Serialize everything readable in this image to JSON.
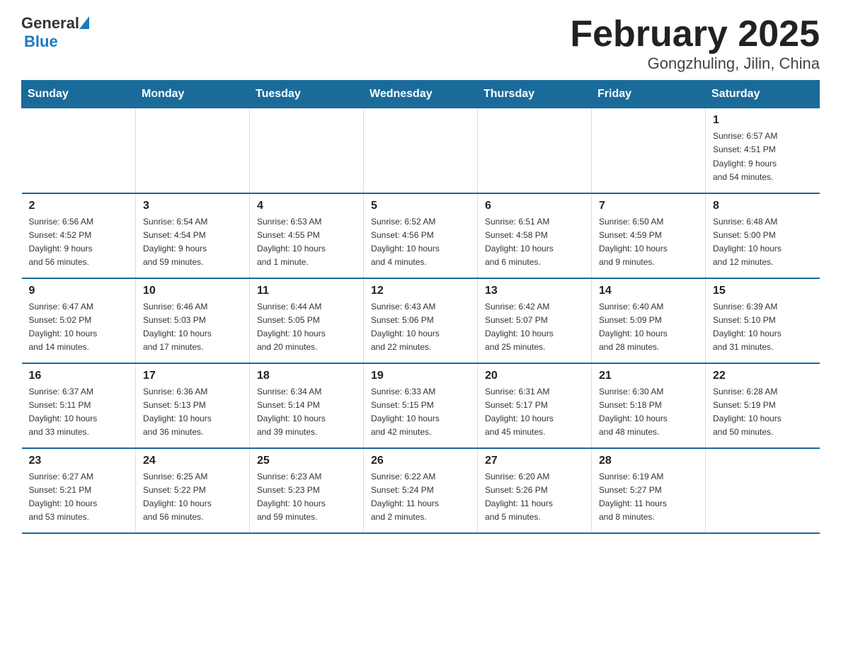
{
  "header": {
    "logo": {
      "text_general": "General",
      "text_blue": "Blue"
    },
    "title": "February 2025",
    "subtitle": "Gongzhuling, Jilin, China"
  },
  "weekdays": [
    "Sunday",
    "Monday",
    "Tuesday",
    "Wednesday",
    "Thursday",
    "Friday",
    "Saturday"
  ],
  "weeks": [
    [
      {
        "day": "",
        "info": ""
      },
      {
        "day": "",
        "info": ""
      },
      {
        "day": "",
        "info": ""
      },
      {
        "day": "",
        "info": ""
      },
      {
        "day": "",
        "info": ""
      },
      {
        "day": "",
        "info": ""
      },
      {
        "day": "1",
        "info": "Sunrise: 6:57 AM\nSunset: 4:51 PM\nDaylight: 9 hours\nand 54 minutes."
      }
    ],
    [
      {
        "day": "2",
        "info": "Sunrise: 6:56 AM\nSunset: 4:52 PM\nDaylight: 9 hours\nand 56 minutes."
      },
      {
        "day": "3",
        "info": "Sunrise: 6:54 AM\nSunset: 4:54 PM\nDaylight: 9 hours\nand 59 minutes."
      },
      {
        "day": "4",
        "info": "Sunrise: 6:53 AM\nSunset: 4:55 PM\nDaylight: 10 hours\nand 1 minute."
      },
      {
        "day": "5",
        "info": "Sunrise: 6:52 AM\nSunset: 4:56 PM\nDaylight: 10 hours\nand 4 minutes."
      },
      {
        "day": "6",
        "info": "Sunrise: 6:51 AM\nSunset: 4:58 PM\nDaylight: 10 hours\nand 6 minutes."
      },
      {
        "day": "7",
        "info": "Sunrise: 6:50 AM\nSunset: 4:59 PM\nDaylight: 10 hours\nand 9 minutes."
      },
      {
        "day": "8",
        "info": "Sunrise: 6:48 AM\nSunset: 5:00 PM\nDaylight: 10 hours\nand 12 minutes."
      }
    ],
    [
      {
        "day": "9",
        "info": "Sunrise: 6:47 AM\nSunset: 5:02 PM\nDaylight: 10 hours\nand 14 minutes."
      },
      {
        "day": "10",
        "info": "Sunrise: 6:46 AM\nSunset: 5:03 PM\nDaylight: 10 hours\nand 17 minutes."
      },
      {
        "day": "11",
        "info": "Sunrise: 6:44 AM\nSunset: 5:05 PM\nDaylight: 10 hours\nand 20 minutes."
      },
      {
        "day": "12",
        "info": "Sunrise: 6:43 AM\nSunset: 5:06 PM\nDaylight: 10 hours\nand 22 minutes."
      },
      {
        "day": "13",
        "info": "Sunrise: 6:42 AM\nSunset: 5:07 PM\nDaylight: 10 hours\nand 25 minutes."
      },
      {
        "day": "14",
        "info": "Sunrise: 6:40 AM\nSunset: 5:09 PM\nDaylight: 10 hours\nand 28 minutes."
      },
      {
        "day": "15",
        "info": "Sunrise: 6:39 AM\nSunset: 5:10 PM\nDaylight: 10 hours\nand 31 minutes."
      }
    ],
    [
      {
        "day": "16",
        "info": "Sunrise: 6:37 AM\nSunset: 5:11 PM\nDaylight: 10 hours\nand 33 minutes."
      },
      {
        "day": "17",
        "info": "Sunrise: 6:36 AM\nSunset: 5:13 PM\nDaylight: 10 hours\nand 36 minutes."
      },
      {
        "day": "18",
        "info": "Sunrise: 6:34 AM\nSunset: 5:14 PM\nDaylight: 10 hours\nand 39 minutes."
      },
      {
        "day": "19",
        "info": "Sunrise: 6:33 AM\nSunset: 5:15 PM\nDaylight: 10 hours\nand 42 minutes."
      },
      {
        "day": "20",
        "info": "Sunrise: 6:31 AM\nSunset: 5:17 PM\nDaylight: 10 hours\nand 45 minutes."
      },
      {
        "day": "21",
        "info": "Sunrise: 6:30 AM\nSunset: 5:18 PM\nDaylight: 10 hours\nand 48 minutes."
      },
      {
        "day": "22",
        "info": "Sunrise: 6:28 AM\nSunset: 5:19 PM\nDaylight: 10 hours\nand 50 minutes."
      }
    ],
    [
      {
        "day": "23",
        "info": "Sunrise: 6:27 AM\nSunset: 5:21 PM\nDaylight: 10 hours\nand 53 minutes."
      },
      {
        "day": "24",
        "info": "Sunrise: 6:25 AM\nSunset: 5:22 PM\nDaylight: 10 hours\nand 56 minutes."
      },
      {
        "day": "25",
        "info": "Sunrise: 6:23 AM\nSunset: 5:23 PM\nDaylight: 10 hours\nand 59 minutes."
      },
      {
        "day": "26",
        "info": "Sunrise: 6:22 AM\nSunset: 5:24 PM\nDaylight: 11 hours\nand 2 minutes."
      },
      {
        "day": "27",
        "info": "Sunrise: 6:20 AM\nSunset: 5:26 PM\nDaylight: 11 hours\nand 5 minutes."
      },
      {
        "day": "28",
        "info": "Sunrise: 6:19 AM\nSunset: 5:27 PM\nDaylight: 11 hours\nand 8 minutes."
      },
      {
        "day": "",
        "info": ""
      }
    ]
  ]
}
